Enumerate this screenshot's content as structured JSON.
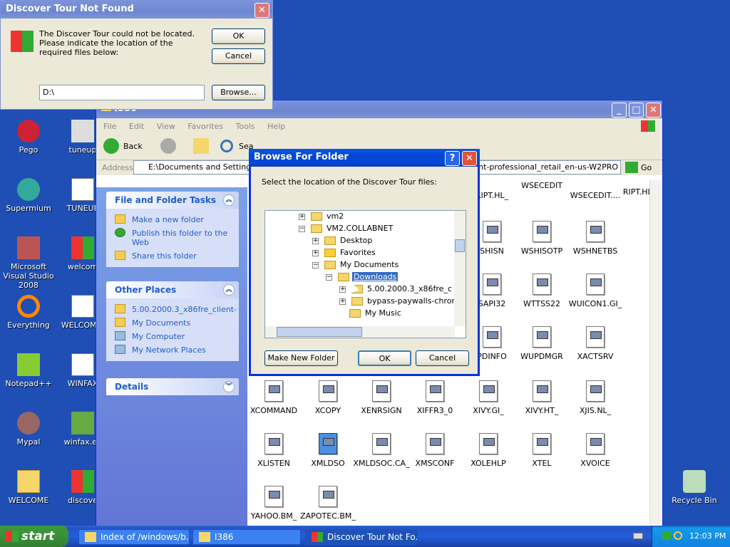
{
  "desktop": {
    "icons": [
      {
        "label": "Pego",
        "color": "#c23"
      },
      {
        "label": "tuneup",
        "color": "#ddd"
      },
      {
        "label": "Supermium",
        "color": "#3a9"
      },
      {
        "label": "TUNEUP",
        "color": "#fff"
      },
      {
        "label": "Microsoft Visual Studio 2008",
        "color": "#b55"
      },
      {
        "label": "welcom",
        "color": "#c33"
      },
      {
        "label": "Everything",
        "color": "#f80"
      },
      {
        "label": "WELCOME.",
        "color": "#fff"
      },
      {
        "label": "Notepad++",
        "color": "#8c3"
      },
      {
        "label": "WINFAX",
        "color": "#fff"
      },
      {
        "label": "Mypal",
        "color": "#966"
      },
      {
        "label": "winfax.ex",
        "color": "#6a4"
      },
      {
        "label": "WELCOME",
        "color": "#f5d66a"
      },
      {
        "label": "discove",
        "color": "#c33"
      },
      {
        "label": "Recycle Bin",
        "color": "#bdb"
      }
    ]
  },
  "discover_dialog": {
    "title": "Discover Tour Not Found",
    "message": "The Discover Tour could not be located.  Please indicate the location of the required files below:",
    "ok": "OK",
    "cancel": "Cancel",
    "path_value": "D:\\",
    "browse": "Browse..."
  },
  "explorer": {
    "title": "I386",
    "menu": [
      "File",
      "Edit",
      "View",
      "Favorites",
      "Tools",
      "Help"
    ],
    "back": "Back",
    "search": "Sea",
    "address_label": "Address",
    "address_value": "E:\\Documents and Settings\\VM2\\My Documents\\Downloads\\5.00.2000.3_x86fre_client-professional_retail_en-us-W2PRO",
    "go": "Go",
    "file_tasks_title": "File and Folder Tasks",
    "file_tasks": [
      "Make a new folder",
      "Publish this folder to the Web",
      "Share this folder"
    ],
    "other_places_title": "Other Places",
    "other_places": [
      "5.00.2000.3_x86fre_client-",
      "My Documents",
      "My Computer",
      "My Network Places"
    ],
    "details_title": "Details",
    "files": [
      "RIPT.HL_",
      "WSECEDIT",
      "WSECEDIT....",
      "SHISN",
      "WSHISOTP",
      "WSHNETBS",
      "SAPI32",
      "WTTSS22",
      "WUICON1.GI_",
      "PDINFO",
      "WUPDMGR",
      "XACTSRV",
      "XCOMMAND",
      "XCOPY",
      "XENRSIGN",
      "XIFFR3_0",
      "XIVY.GI_",
      "XIVY.HT_",
      "XJIS.NL_",
      "XLISTEN",
      "XMLDSO",
      "XMLDSOC.CA_",
      "XMSCONF",
      "XOLEHLP",
      "XTEL",
      "XVOICE",
      "YAHOO.BM_",
      "ZAPOTEC.BM_"
    ]
  },
  "browse_dialog": {
    "title": "Browse For Folder",
    "instruction": "Select the location of the Discover Tour files:",
    "tree": [
      "vm2",
      "VM2.COLLABNET",
      "Desktop",
      "Favorites",
      "My Documents",
      "Downloads",
      "5.00.2000.3_x86fre_c",
      "bypass-paywalls-chron",
      "My Music"
    ],
    "new_folder": "Make New Folder",
    "ok": "OK",
    "cancel": "Cancel"
  },
  "taskbar": {
    "start": "start",
    "tasks": [
      "Index of /windows/b...",
      "I386",
      "Discover Tour Not Fo..."
    ],
    "clock": "12:03 PM"
  }
}
